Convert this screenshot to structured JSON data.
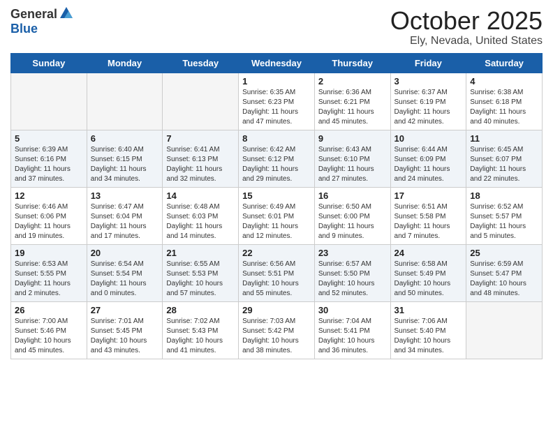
{
  "header": {
    "logo_general": "General",
    "logo_blue": "Blue",
    "main_title": "October 2025",
    "subtitle": "Ely, Nevada, United States"
  },
  "calendar": {
    "days_of_week": [
      "Sunday",
      "Monday",
      "Tuesday",
      "Wednesday",
      "Thursday",
      "Friday",
      "Saturday"
    ],
    "weeks": [
      {
        "days": [
          {
            "number": "",
            "info": ""
          },
          {
            "number": "",
            "info": ""
          },
          {
            "number": "",
            "info": ""
          },
          {
            "number": "1",
            "info": "Sunrise: 6:35 AM\nSunset: 6:23 PM\nDaylight: 11 hours and 47 minutes."
          },
          {
            "number": "2",
            "info": "Sunrise: 6:36 AM\nSunset: 6:21 PM\nDaylight: 11 hours and 45 minutes."
          },
          {
            "number": "3",
            "info": "Sunrise: 6:37 AM\nSunset: 6:19 PM\nDaylight: 11 hours and 42 minutes."
          },
          {
            "number": "4",
            "info": "Sunrise: 6:38 AM\nSunset: 6:18 PM\nDaylight: 11 hours and 40 minutes."
          }
        ]
      },
      {
        "days": [
          {
            "number": "5",
            "info": "Sunrise: 6:39 AM\nSunset: 6:16 PM\nDaylight: 11 hours and 37 minutes."
          },
          {
            "number": "6",
            "info": "Sunrise: 6:40 AM\nSunset: 6:15 PM\nDaylight: 11 hours and 34 minutes."
          },
          {
            "number": "7",
            "info": "Sunrise: 6:41 AM\nSunset: 6:13 PM\nDaylight: 11 hours and 32 minutes."
          },
          {
            "number": "8",
            "info": "Sunrise: 6:42 AM\nSunset: 6:12 PM\nDaylight: 11 hours and 29 minutes."
          },
          {
            "number": "9",
            "info": "Sunrise: 6:43 AM\nSunset: 6:10 PM\nDaylight: 11 hours and 27 minutes."
          },
          {
            "number": "10",
            "info": "Sunrise: 6:44 AM\nSunset: 6:09 PM\nDaylight: 11 hours and 24 minutes."
          },
          {
            "number": "11",
            "info": "Sunrise: 6:45 AM\nSunset: 6:07 PM\nDaylight: 11 hours and 22 minutes."
          }
        ]
      },
      {
        "days": [
          {
            "number": "12",
            "info": "Sunrise: 6:46 AM\nSunset: 6:06 PM\nDaylight: 11 hours and 19 minutes."
          },
          {
            "number": "13",
            "info": "Sunrise: 6:47 AM\nSunset: 6:04 PM\nDaylight: 11 hours and 17 minutes."
          },
          {
            "number": "14",
            "info": "Sunrise: 6:48 AM\nSunset: 6:03 PM\nDaylight: 11 hours and 14 minutes."
          },
          {
            "number": "15",
            "info": "Sunrise: 6:49 AM\nSunset: 6:01 PM\nDaylight: 11 hours and 12 minutes."
          },
          {
            "number": "16",
            "info": "Sunrise: 6:50 AM\nSunset: 6:00 PM\nDaylight: 11 hours and 9 minutes."
          },
          {
            "number": "17",
            "info": "Sunrise: 6:51 AM\nSunset: 5:58 PM\nDaylight: 11 hours and 7 minutes."
          },
          {
            "number": "18",
            "info": "Sunrise: 6:52 AM\nSunset: 5:57 PM\nDaylight: 11 hours and 5 minutes."
          }
        ]
      },
      {
        "days": [
          {
            "number": "19",
            "info": "Sunrise: 6:53 AM\nSunset: 5:55 PM\nDaylight: 11 hours and 2 minutes."
          },
          {
            "number": "20",
            "info": "Sunrise: 6:54 AM\nSunset: 5:54 PM\nDaylight: 11 hours and 0 minutes."
          },
          {
            "number": "21",
            "info": "Sunrise: 6:55 AM\nSunset: 5:53 PM\nDaylight: 10 hours and 57 minutes."
          },
          {
            "number": "22",
            "info": "Sunrise: 6:56 AM\nSunset: 5:51 PM\nDaylight: 10 hours and 55 minutes."
          },
          {
            "number": "23",
            "info": "Sunrise: 6:57 AM\nSunset: 5:50 PM\nDaylight: 10 hours and 52 minutes."
          },
          {
            "number": "24",
            "info": "Sunrise: 6:58 AM\nSunset: 5:49 PM\nDaylight: 10 hours and 50 minutes."
          },
          {
            "number": "25",
            "info": "Sunrise: 6:59 AM\nSunset: 5:47 PM\nDaylight: 10 hours and 48 minutes."
          }
        ]
      },
      {
        "days": [
          {
            "number": "26",
            "info": "Sunrise: 7:00 AM\nSunset: 5:46 PM\nDaylight: 10 hours and 45 minutes."
          },
          {
            "number": "27",
            "info": "Sunrise: 7:01 AM\nSunset: 5:45 PM\nDaylight: 10 hours and 43 minutes."
          },
          {
            "number": "28",
            "info": "Sunrise: 7:02 AM\nSunset: 5:43 PM\nDaylight: 10 hours and 41 minutes."
          },
          {
            "number": "29",
            "info": "Sunrise: 7:03 AM\nSunset: 5:42 PM\nDaylight: 10 hours and 38 minutes."
          },
          {
            "number": "30",
            "info": "Sunrise: 7:04 AM\nSunset: 5:41 PM\nDaylight: 10 hours and 36 minutes."
          },
          {
            "number": "31",
            "info": "Sunrise: 7:06 AM\nSunset: 5:40 PM\nDaylight: 10 hours and 34 minutes."
          },
          {
            "number": "",
            "info": ""
          }
        ]
      }
    ]
  }
}
